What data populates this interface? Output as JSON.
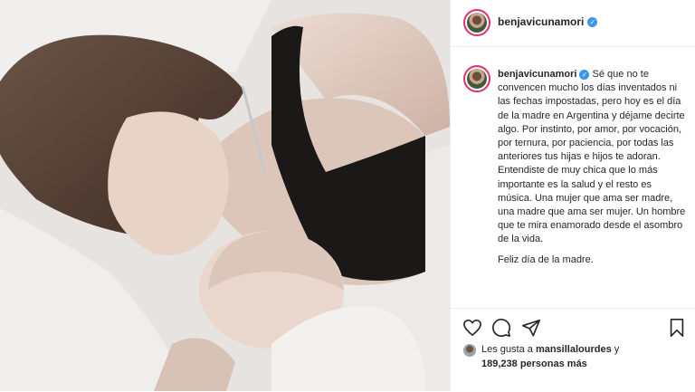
{
  "post": {
    "username": "benjavicunamori",
    "verified_mark": "✓",
    "caption": [
      "Sé que no te convencen mucho los días inventados ni las fechas impostadas, pero hoy es el día de la madre en Argentina y déjame decirte algo. Por instinto, por amor, por vocación, por ternura, por paciencia, por todas las anteriores tus hijas e hijos te adoran. Entendiste de muy chica que lo más importante es la salud y el resto es música. Una mujer que ama ser madre, una madre que ama ser mujer. Un hombre que te mira enamorado desde el asombro de la vida.",
      "Feliz día de la madre."
    ],
    "likes": {
      "prefix": "Les gusta a",
      "user": "mansillalourdes",
      "connector": "y",
      "count": "189,238 personas más"
    }
  },
  "icons": {
    "like": "heart-icon",
    "comment": "comment-icon",
    "share": "share-icon",
    "save": "bookmark-icon",
    "verified": "verified-badge-icon"
  },
  "colors": {
    "verified": "#3897f0",
    "text": "#262626",
    "story_ring": "#e1306c"
  }
}
